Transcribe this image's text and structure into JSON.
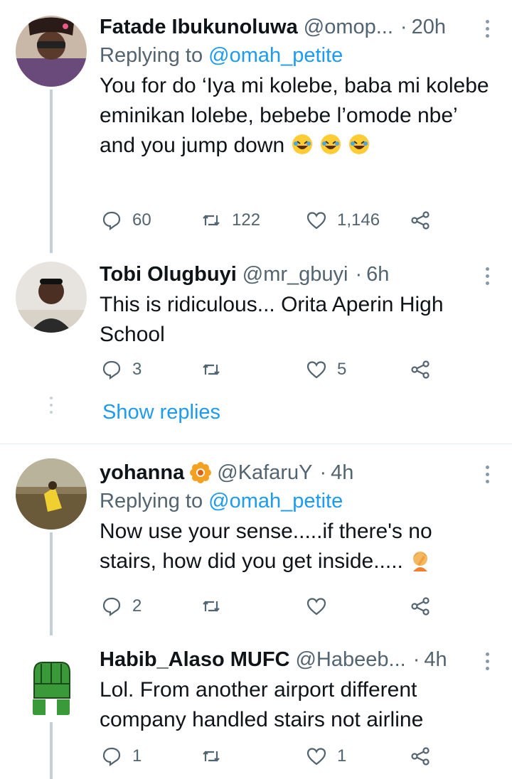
{
  "tweets": [
    {
      "name": "Fatade Ibukunoluwa",
      "handle": "@omop...",
      "time": "20h",
      "replying_prefix": "Replying to ",
      "replying_to": "@omah_petite",
      "text": "You for do ‘Iya mi kolebe, baba mi kolebe eminikan lolebe, bebebe l’omode nbe’ and you jump down",
      "emoji": "rolling-on-floor-laughing",
      "replies": "60",
      "retweets": "122",
      "likes": "1,146"
    },
    {
      "name": "Tobi Olugbuyi",
      "handle": "@mr_gbuyi",
      "time": "6h",
      "text": "This is ridiculous... Orita Aperin High School",
      "replies": "3",
      "retweets": "",
      "likes": "5"
    },
    {
      "name": "yohanna",
      "handle": "@KafaruY",
      "time": "4h",
      "replying_prefix": "Replying to ",
      "replying_to": "@omah_petite",
      "text": "Now use your sense.....if there's no stairs, how did you get inside.....",
      "emoji": "person-facepalming",
      "badge": "sunflower",
      "replies": "2",
      "retweets": "",
      "likes": ""
    },
    {
      "name": "Habib_Alaso MUFC",
      "handle": "@Habeeb...",
      "time": "4h",
      "text": "Lol. From another airport different company handled stairs not airline",
      "replies": "1",
      "retweets": "",
      "likes": "1"
    }
  ],
  "show_replies": "Show replies",
  "colors": {
    "accent": "#1d9bf0",
    "secondary_text": "#536471",
    "thread_line": "#c4cfd6"
  },
  "icons": [
    "reply-icon",
    "retweet-icon",
    "like-icon",
    "share-icon",
    "more-icon"
  ]
}
